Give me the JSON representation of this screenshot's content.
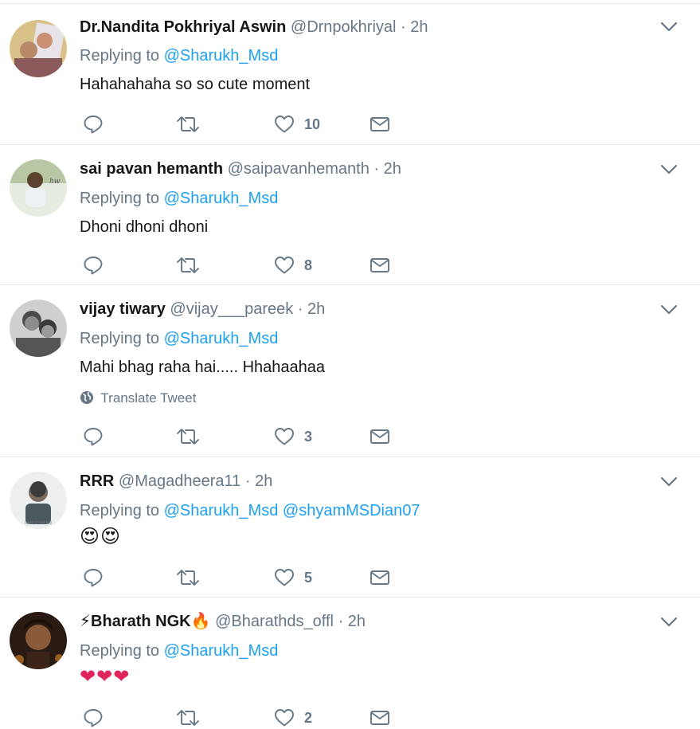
{
  "replying_prefix": "Replying to",
  "translate_label": "Translate Tweet",
  "tweets": [
    {
      "name": "Dr.Nandita Pokhriyal Aswin",
      "handle": "@Drnpokhriyal",
      "separator": "·",
      "time": "2h",
      "mentions": [
        "@Sharukh_Msd"
      ],
      "text": "Hahahahaha so so cute moment",
      "likes": "10",
      "avatar_icon": "user-photo-icon"
    },
    {
      "name": "sai pavan hemanth",
      "handle": "@saipavanhemanth",
      "separator": "·",
      "time": "2h",
      "mentions": [
        "@Sharukh_Msd"
      ],
      "text": "Dhoni dhoni dhoni",
      "likes": "8",
      "avatar_icon": "user-photo-icon"
    },
    {
      "name": "vijay tiwary",
      "handle": "@vijay___pareek",
      "separator": "·",
      "time": "2h",
      "mentions": [
        "@Sharukh_Msd"
      ],
      "text": "Mahi bhag raha hai..... Hhahaahaa",
      "likes": "3",
      "avatar_icon": "user-photo-icon"
    },
    {
      "name": "RRR",
      "handle": "@Magadheera11",
      "separator": "·",
      "time": "2h",
      "mentions": [
        "@Sharukh_Msd",
        "@shyamMSDian07"
      ],
      "text": "😍😍",
      "likes": "5",
      "avatar_icon": "user-photo-icon"
    },
    {
      "name": "⚡Bharath NGK🔥",
      "handle": "@Bharathds_offl",
      "separator": "·",
      "time": "2h",
      "mentions": [
        "@Sharukh_Msd"
      ],
      "text": "❤❤❤",
      "likes": "2",
      "avatar_icon": "user-photo-icon"
    }
  ],
  "colors": {
    "link": "#1da1f2",
    "muted": "#657786",
    "text": "#14171a",
    "divider": "#e6ecf0",
    "heart": "#e0245e"
  }
}
